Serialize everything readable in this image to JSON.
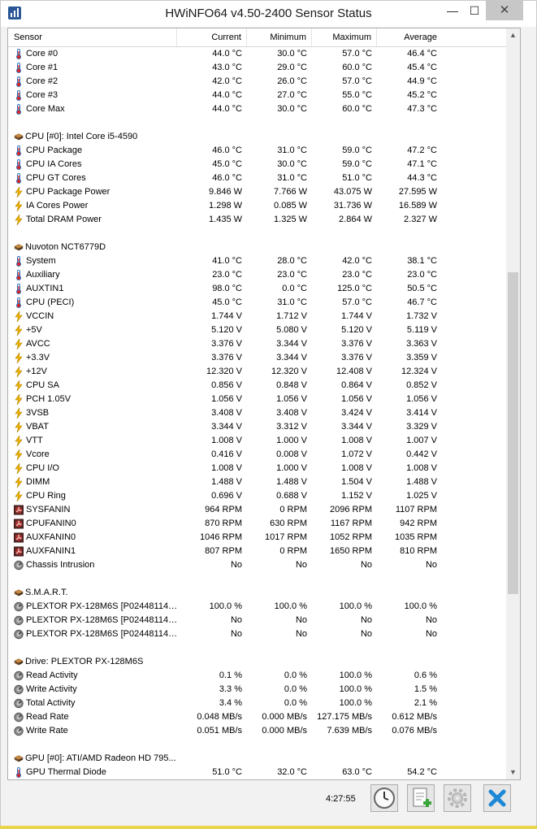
{
  "window": {
    "title": "HWiNFO64 v4.50-2400 Sensor Status",
    "minimize": "—",
    "maximize": "☐",
    "close": "✕"
  },
  "columns": {
    "sensor": "Sensor",
    "current": "Current",
    "minimum": "Minimum",
    "maximum": "Maximum",
    "average": "Average"
  },
  "rows": [
    {
      "type": "item",
      "icon": "thermometer-icon",
      "name": "Core #0",
      "cur": "44.0 °C",
      "min": "30.0 °C",
      "max": "57.0 °C",
      "avg": "46.4 °C"
    },
    {
      "type": "item",
      "icon": "thermometer-icon",
      "name": "Core #1",
      "cur": "43.0 °C",
      "min": "29.0 °C",
      "max": "60.0 °C",
      "avg": "45.4 °C"
    },
    {
      "type": "item",
      "icon": "thermometer-icon",
      "name": "Core #2",
      "cur": "42.0 °C",
      "min": "26.0 °C",
      "max": "57.0 °C",
      "avg": "44.9 °C"
    },
    {
      "type": "item",
      "icon": "thermometer-icon",
      "name": "Core #3",
      "cur": "44.0 °C",
      "min": "27.0 °C",
      "max": "55.0 °C",
      "avg": "45.2 °C"
    },
    {
      "type": "item",
      "icon": "thermometer-icon",
      "name": "Core Max",
      "cur": "44.0 °C",
      "min": "30.0 °C",
      "max": "60.0 °C",
      "avg": "47.3 °C"
    },
    {
      "type": "blank"
    },
    {
      "type": "group",
      "icon": "chip-icon",
      "name": "CPU [#0]: Intel Core i5-4590"
    },
    {
      "type": "item",
      "icon": "thermometer-icon",
      "name": "CPU Package",
      "cur": "46.0 °C",
      "min": "31.0 °C",
      "max": "59.0 °C",
      "avg": "47.2 °C"
    },
    {
      "type": "item",
      "icon": "thermometer-icon",
      "name": "CPU IA Cores",
      "cur": "45.0 °C",
      "min": "30.0 °C",
      "max": "59.0 °C",
      "avg": "47.1 °C"
    },
    {
      "type": "item",
      "icon": "thermometer-icon",
      "name": "CPU GT Cores",
      "cur": "46.0 °C",
      "min": "31.0 °C",
      "max": "51.0 °C",
      "avg": "44.3 °C"
    },
    {
      "type": "item",
      "icon": "lightning-icon",
      "name": "CPU Package Power",
      "cur": "9.846 W",
      "min": "7.766 W",
      "max": "43.075 W",
      "avg": "27.595 W"
    },
    {
      "type": "item",
      "icon": "lightning-icon",
      "name": "IA Cores Power",
      "cur": "1.298 W",
      "min": "0.085 W",
      "max": "31.736 W",
      "avg": "16.589 W"
    },
    {
      "type": "item",
      "icon": "lightning-icon",
      "name": "Total DRAM Power",
      "cur": "1.435 W",
      "min": "1.325 W",
      "max": "2.864 W",
      "avg": "2.327 W"
    },
    {
      "type": "blank"
    },
    {
      "type": "group",
      "icon": "chip-icon",
      "name": "Nuvoton NCT6779D"
    },
    {
      "type": "item",
      "icon": "thermometer-icon",
      "name": "System",
      "cur": "41.0 °C",
      "min": "28.0 °C",
      "max": "42.0 °C",
      "avg": "38.1 °C"
    },
    {
      "type": "item",
      "icon": "thermometer-icon",
      "name": "Auxiliary",
      "cur": "23.0 °C",
      "min": "23.0 °C",
      "max": "23.0 °C",
      "avg": "23.0 °C"
    },
    {
      "type": "item",
      "icon": "thermometer-icon",
      "name": "AUXTIN1",
      "cur": "98.0 °C",
      "min": "0.0 °C",
      "max": "125.0 °C",
      "avg": "50.5 °C"
    },
    {
      "type": "item",
      "icon": "thermometer-icon",
      "name": "CPU (PECI)",
      "cur": "45.0 °C",
      "min": "31.0 °C",
      "max": "57.0 °C",
      "avg": "46.7 °C"
    },
    {
      "type": "item",
      "icon": "lightning-icon",
      "name": "VCCIN",
      "cur": "1.744 V",
      "min": "1.712 V",
      "max": "1.744 V",
      "avg": "1.732 V"
    },
    {
      "type": "item",
      "icon": "lightning-icon",
      "name": "+5V",
      "cur": "5.120 V",
      "min": "5.080 V",
      "max": "5.120 V",
      "avg": "5.119 V"
    },
    {
      "type": "item",
      "icon": "lightning-icon",
      "name": "AVCC",
      "cur": "3.376 V",
      "min": "3.344 V",
      "max": "3.376 V",
      "avg": "3.363 V"
    },
    {
      "type": "item",
      "icon": "lightning-icon",
      "name": "+3.3V",
      "cur": "3.376 V",
      "min": "3.344 V",
      "max": "3.376 V",
      "avg": "3.359 V"
    },
    {
      "type": "item",
      "icon": "lightning-icon",
      "name": "+12V",
      "cur": "12.320 V",
      "min": "12.320 V",
      "max": "12.408 V",
      "avg": "12.324 V"
    },
    {
      "type": "item",
      "icon": "lightning-icon",
      "name": "CPU SA",
      "cur": "0.856 V",
      "min": "0.848 V",
      "max": "0.864 V",
      "avg": "0.852 V"
    },
    {
      "type": "item",
      "icon": "lightning-icon",
      "name": "PCH 1.05V",
      "cur": "1.056 V",
      "min": "1.056 V",
      "max": "1.056 V",
      "avg": "1.056 V"
    },
    {
      "type": "item",
      "icon": "lightning-icon",
      "name": "3VSB",
      "cur": "3.408 V",
      "min": "3.408 V",
      "max": "3.424 V",
      "avg": "3.414 V"
    },
    {
      "type": "item",
      "icon": "lightning-icon",
      "name": "VBAT",
      "cur": "3.344 V",
      "min": "3.312 V",
      "max": "3.344 V",
      "avg": "3.329 V"
    },
    {
      "type": "item",
      "icon": "lightning-icon",
      "name": "VTT",
      "cur": "1.008 V",
      "min": "1.000 V",
      "max": "1.008 V",
      "avg": "1.007 V"
    },
    {
      "type": "item",
      "icon": "lightning-icon",
      "name": "Vcore",
      "cur": "0.416 V",
      "min": "0.008 V",
      "max": "1.072 V",
      "avg": "0.442 V"
    },
    {
      "type": "item",
      "icon": "lightning-icon",
      "name": "CPU I/O",
      "cur": "1.008 V",
      "min": "1.000 V",
      "max": "1.008 V",
      "avg": "1.008 V"
    },
    {
      "type": "item",
      "icon": "lightning-icon",
      "name": "DIMM",
      "cur": "1.488 V",
      "min": "1.488 V",
      "max": "1.504 V",
      "avg": "1.488 V"
    },
    {
      "type": "item",
      "icon": "lightning-icon",
      "name": "CPU Ring",
      "cur": "0.696 V",
      "min": "0.688 V",
      "max": "1.152 V",
      "avg": "1.025 V"
    },
    {
      "type": "item",
      "icon": "fan-icon",
      "name": "SYSFANIN",
      "cur": "964 RPM",
      "min": "0 RPM",
      "max": "2096 RPM",
      "avg": "1107 RPM"
    },
    {
      "type": "item",
      "icon": "fan-icon",
      "name": "CPUFANIN0",
      "cur": "870 RPM",
      "min": "630 RPM",
      "max": "1167 RPM",
      "avg": "942 RPM"
    },
    {
      "type": "item",
      "icon": "fan-icon",
      "name": "AUXFANIN0",
      "cur": "1046 RPM",
      "min": "1017 RPM",
      "max": "1052 RPM",
      "avg": "1035 RPM"
    },
    {
      "type": "item",
      "icon": "fan-icon",
      "name": "AUXFANIN1",
      "cur": "807 RPM",
      "min": "0 RPM",
      "max": "1650 RPM",
      "avg": "810 RPM"
    },
    {
      "type": "item",
      "icon": "gauge-icon",
      "name": "Chassis Intrusion",
      "cur": "No",
      "min": "No",
      "max": "No",
      "avg": "No"
    },
    {
      "type": "blank"
    },
    {
      "type": "group",
      "icon": "chip-icon",
      "name": "S.M.A.R.T."
    },
    {
      "type": "item",
      "icon": "gauge-icon",
      "name": "PLEXTOR PX-128M6S [P0244811461...",
      "cur": "100.0 %",
      "min": "100.0 %",
      "max": "100.0 %",
      "avg": "100.0 %"
    },
    {
      "type": "item",
      "icon": "gauge-icon",
      "name": "PLEXTOR PX-128M6S [P0244811461...",
      "cur": "No",
      "min": "No",
      "max": "No",
      "avg": "No"
    },
    {
      "type": "item",
      "icon": "gauge-icon",
      "name": "PLEXTOR PX-128M6S [P0244811461...",
      "cur": "No",
      "min": "No",
      "max": "No",
      "avg": "No"
    },
    {
      "type": "blank"
    },
    {
      "type": "group",
      "icon": "chip-icon",
      "name": "Drive: PLEXTOR PX-128M6S"
    },
    {
      "type": "item",
      "icon": "gauge-icon",
      "name": "Read Activity",
      "cur": "0.1 %",
      "min": "0.0 %",
      "max": "100.0 %",
      "avg": "0.6 %"
    },
    {
      "type": "item",
      "icon": "gauge-icon",
      "name": "Write Activity",
      "cur": "3.3 %",
      "min": "0.0 %",
      "max": "100.0 %",
      "avg": "1.5 %"
    },
    {
      "type": "item",
      "icon": "gauge-icon",
      "name": "Total Activity",
      "cur": "3.4 %",
      "min": "0.0 %",
      "max": "100.0 %",
      "avg": "2.1 %"
    },
    {
      "type": "item",
      "icon": "gauge-icon",
      "name": "Read Rate",
      "cur": "0.048 MB/s",
      "min": "0.000 MB/s",
      "max": "127.175 MB/s",
      "avg": "0.612 MB/s"
    },
    {
      "type": "item",
      "icon": "gauge-icon",
      "name": "Write Rate",
      "cur": "0.051 MB/s",
      "min": "0.000 MB/s",
      "max": "7.639 MB/s",
      "avg": "0.076 MB/s"
    },
    {
      "type": "blank"
    },
    {
      "type": "group",
      "icon": "chip-icon",
      "name": "GPU [#0]: ATI/AMD Radeon HD 795..."
    },
    {
      "type": "item",
      "icon": "thermometer-icon",
      "name": "GPU Thermal Diode",
      "cur": "51.0 °C",
      "min": "32.0 °C",
      "max": "63.0 °C",
      "avg": "54.2 °C"
    }
  ],
  "status": {
    "clock": "4:27:55"
  },
  "toolbar": [
    {
      "name": "clock-button",
      "icon": "clock-icon"
    },
    {
      "name": "add-report-button",
      "icon": "document-add-icon"
    },
    {
      "name": "settings-button",
      "icon": "gear-icon"
    },
    {
      "name": "close-sensors-button",
      "icon": "close-icon"
    }
  ],
  "colors": {
    "thermometer": "#2f6fb8",
    "lightning": "#f0b400",
    "fan": "#b0302a",
    "chip": "#8a5a2b",
    "close_x": "#1e88d6"
  }
}
